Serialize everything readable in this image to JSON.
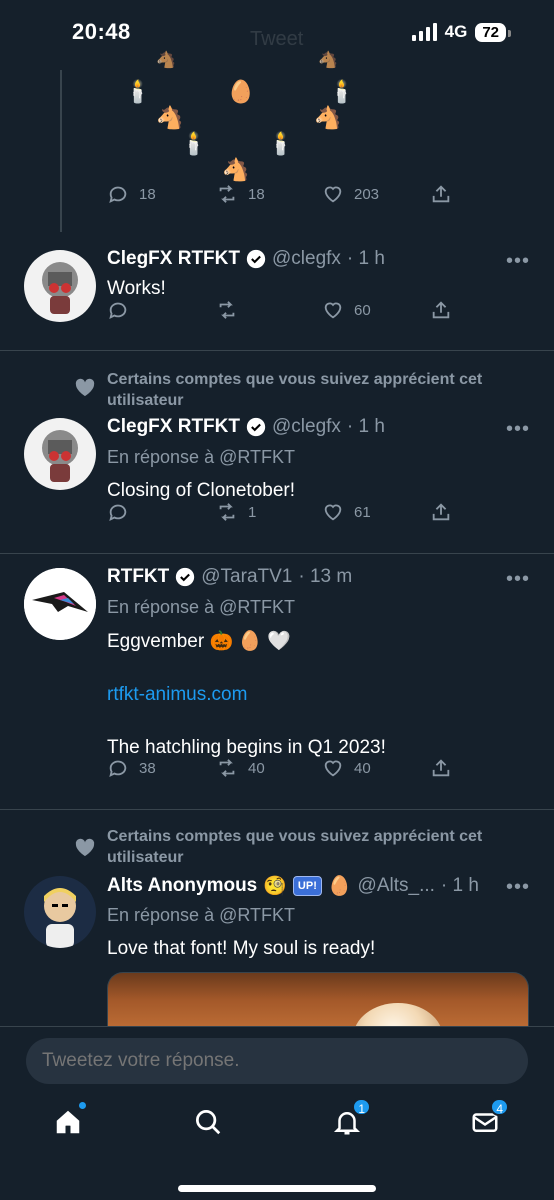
{
  "status": {
    "time": "20:48",
    "network": "4G",
    "battery": "72"
  },
  "header": {
    "faded_title": "Tweet"
  },
  "art_glyphs": [
    "🕯️",
    "🥚",
    "🕯️",
    "🐴",
    "🐴",
    "🕯️",
    "🕯️",
    "🐴",
    "🐴",
    "🐴"
  ],
  "tweet0": {
    "replies": "18",
    "retweets": "18",
    "likes": "203"
  },
  "tweet1": {
    "name": "ClegFX RTFKT",
    "handle": "@clegfx",
    "time": "· 1 h",
    "text": "Works!",
    "replies": "",
    "retweets": "",
    "likes": "60"
  },
  "tweet2": {
    "context": "Certains comptes que vous suivez apprécient cet utilisateur",
    "name": "ClegFX RTFKT",
    "handle": "@clegfx",
    "time": "· 1 h",
    "reply_to": "En réponse à @RTFKT",
    "text": "Closing of Clonetober!",
    "replies": "",
    "retweets": "1",
    "likes": "61"
  },
  "tweet3": {
    "name": "RTFKT",
    "handle": "@TaraTV1",
    "time": "· 13 m",
    "reply_to": "En réponse à @RTFKT",
    "line1": "Eggvember 🎃 🥚 🤍",
    "link": "rtfkt-animus.com",
    "line2": "The hatchling begins in Q1 2023!",
    "replies": "38",
    "retweets": "40",
    "likes": "40"
  },
  "tweet4": {
    "context": "Certains comptes que vous suivez apprécient cet utilisateur",
    "name": "Alts Anonymous",
    "emoji1": "🧐",
    "badge": "UP!",
    "emoji2": "🥚",
    "handle": "@Alts_...",
    "time": "· 1 h",
    "reply_to": "En réponse à @RTFKT",
    "text": "Love that font! My soul is ready!"
  },
  "reply": {
    "placeholder": "Tweetez votre réponse."
  },
  "tabs": {
    "notifications_badge": "1",
    "messages_badge": "4"
  },
  "colors": {
    "background": "#15202b",
    "accent": "#1d9bf0",
    "muted": "#8b98a5",
    "divider": "#38444d"
  }
}
